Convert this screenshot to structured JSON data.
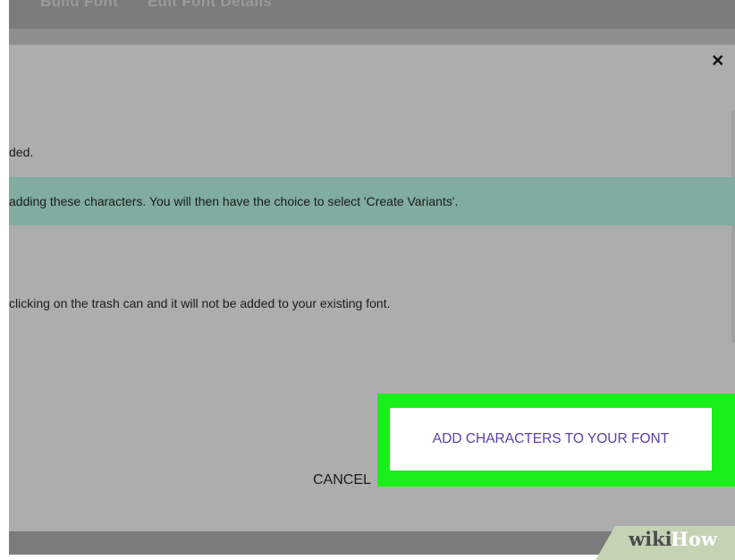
{
  "nav": {
    "item_1": "Build Font",
    "item_2": "Edit Font Details"
  },
  "dialog": {
    "close_label": "×",
    "message_1": "ded.",
    "banner_text": "adding these characters. You will then have the choice to select 'Create Variants'.",
    "message_3": "clicking on the trash can and it will not be added to your existing font.",
    "cancel_label": "CANCEL",
    "add_label": "ADD CHARACTERS TO YOUR FONT"
  },
  "watermark": {
    "wiki": "wiki",
    "how": "How"
  },
  "colors": {
    "banner": "#80ada0",
    "highlight": "#19f019",
    "button_text": "#5b3ea8"
  }
}
